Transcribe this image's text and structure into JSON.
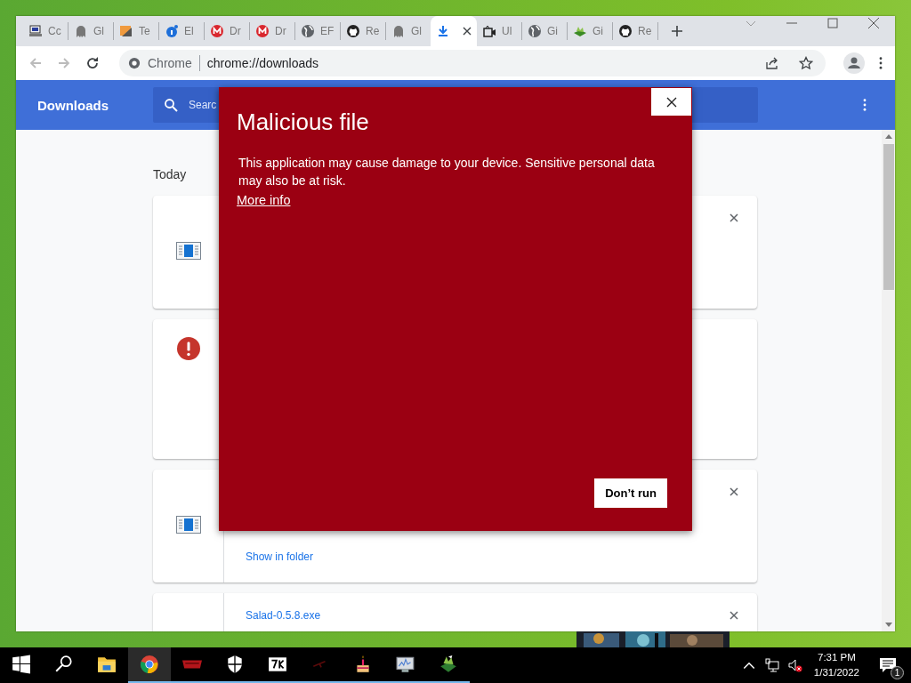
{
  "tabs": [
    {
      "kind": "computer",
      "title": "Cc",
      "selected": false
    },
    {
      "kind": "ghost",
      "title": "Gl",
      "selected": false
    },
    {
      "kind": "slides",
      "title": "Te",
      "selected": false
    },
    {
      "kind": "info",
      "title": "El",
      "selected": false
    },
    {
      "kind": "mega",
      "title": "Dr",
      "selected": false
    },
    {
      "kind": "mega",
      "title": "Dr",
      "selected": false
    },
    {
      "kind": "globe",
      "title": "EF",
      "selected": false
    },
    {
      "kind": "github",
      "title": "Re",
      "selected": false
    },
    {
      "kind": "ghost",
      "title": "Gl",
      "selected": false
    },
    {
      "kind": "download",
      "selected": true
    },
    {
      "kind": "camera",
      "title": "Ul",
      "selected": false
    },
    {
      "kind": "globe",
      "title": "Gi",
      "selected": false
    },
    {
      "kind": "plant",
      "title": "Gi",
      "selected": false
    },
    {
      "kind": "github",
      "title": "Re",
      "selected": false
    }
  ],
  "address": {
    "chip": "Chrome",
    "url": "chrome://downloads"
  },
  "page": {
    "title": "Downloads",
    "search": {
      "placeholder": "Searc"
    },
    "section": "Today",
    "items": [
      {
        "kind": "app",
        "closable": true
      },
      {
        "kind": "warning",
        "closable": false
      },
      {
        "kind": "app",
        "closable": true,
        "link": "Show in folder"
      },
      {
        "kind": "none",
        "closable": true,
        "name": "Salad-0.5.8.exe"
      }
    ]
  },
  "dialog": {
    "title": "Malicious file",
    "message": "This application may cause damage to your device. Sensitive personal data may also be at risk.",
    "link": "More info",
    "button": "Don’t run"
  },
  "taskbar": {
    "apps": [
      {
        "kind": "start",
        "running": false,
        "selected": false
      },
      {
        "kind": "search",
        "running": false,
        "selected": false
      },
      {
        "kind": "folder",
        "running": false,
        "selected": false
      },
      {
        "kind": "chrome",
        "running": true,
        "selected": true
      },
      {
        "kind": "redbar",
        "running": true,
        "selected": false
      },
      {
        "kind": "shield",
        "running": true,
        "selected": false
      },
      {
        "kind": "sevenzip",
        "running": true,
        "selected": false
      },
      {
        "kind": "dark",
        "running": true,
        "selected": false
      },
      {
        "kind": "cake",
        "running": true,
        "selected": false
      },
      {
        "kind": "monitor",
        "running": true,
        "selected": false
      },
      {
        "kind": "plant",
        "running": true,
        "selected": false
      }
    ],
    "time": "7:31 PM",
    "date": "1/31/2022",
    "notifications": "1"
  }
}
